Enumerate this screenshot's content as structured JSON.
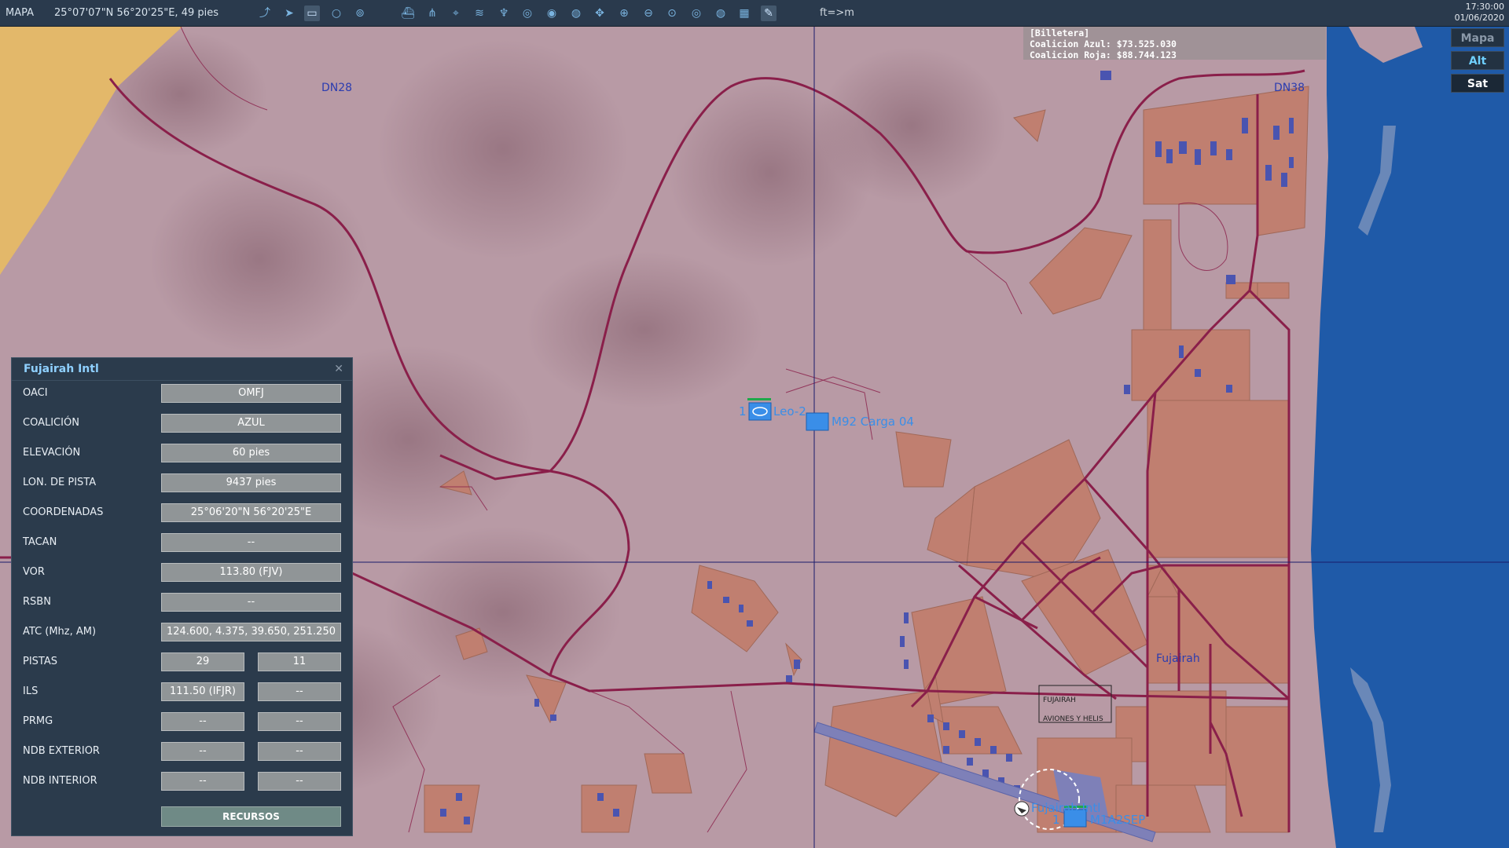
{
  "topbar": {
    "mode": "MAPA",
    "coordinates": "25°07'07\"N 56°20'25\"E, 49 pies",
    "units_toggle": "ft=>m",
    "time": "17:30:00",
    "date": "01/06/2020",
    "tools": [
      "route-icon",
      "navigate-icon",
      "layer-toggle-icon",
      "circle-icon",
      "bubble-icon",
      "ship-icon",
      "network-icon",
      "crosshair-icon",
      "signal-icon",
      "tower-icon",
      "radar-icon",
      "radar2-icon",
      "radar3-icon",
      "move-icon",
      "zoom-in-icon",
      "zoom-out-icon",
      "zoom-fit-icon",
      "target-icon",
      "globe-icon",
      "grid-icon",
      "pencil-icon"
    ]
  },
  "wallet": {
    "title": "[Billetera]",
    "blue": "Coalicion Azul: $73.525.030",
    "red": "Coalicion Roja: $88.744.123"
  },
  "layers": [
    "Mapa",
    "Alt",
    "Sat"
  ],
  "map": {
    "grid_labels": [
      "DN28",
      "DN38"
    ],
    "city_label": "Fujairah",
    "units": {
      "leo": "Leo-2",
      "leo_count": "1",
      "m92": "M92 Carga 04",
      "airport": "Fujairah Intl",
      "m1": "M1A2SEP",
      "m1_count": "1"
    },
    "zone_box": [
      "FUJAIRAH",
      "AVIONES Y HELIS"
    ]
  },
  "panel": {
    "title": "Fujairah Intl",
    "rows": [
      {
        "key": "OACI",
        "value": "OMFJ"
      },
      {
        "key": "COALICIÓN",
        "value": "AZUL"
      },
      {
        "key": "ELEVACIÓN",
        "value": "60 pies"
      },
      {
        "key": "LON. DE PISTA",
        "value": "9437 pies"
      },
      {
        "key": "COORDENADAS",
        "value": "25°06'20\"N 56°20'25\"E"
      },
      {
        "key": "TACAN",
        "value": "--"
      },
      {
        "key": "VOR",
        "value": "113.80 (FJV)"
      },
      {
        "key": "RSBN",
        "value": "--"
      },
      {
        "key": "ATC  (Mhz, AM)",
        "value": "124.600, 4.375, 39.650, 251.250"
      }
    ],
    "pair_rows": [
      {
        "key": "PISTAS",
        "left": "29",
        "right": "11"
      },
      {
        "key": "ILS",
        "left": "111.50 (IFJR)",
        "right": "--"
      },
      {
        "key": "PRMG",
        "left": "--",
        "right": "--"
      },
      {
        "key": "NDB EXTERIOR",
        "left": "--",
        "right": "--"
      },
      {
        "key": "NDB INTERIOR",
        "left": "--",
        "right": "--"
      }
    ],
    "resources_button": "RECURSOS"
  },
  "colors": {
    "land": "#b89aa5",
    "sea": "#1f5aa8",
    "road": "#8a1f4a",
    "urban": "#c07f70",
    "desert": "#e3b86a",
    "panel_bg": "#2b3b4c",
    "blue_unit": "#3a8ee8"
  }
}
